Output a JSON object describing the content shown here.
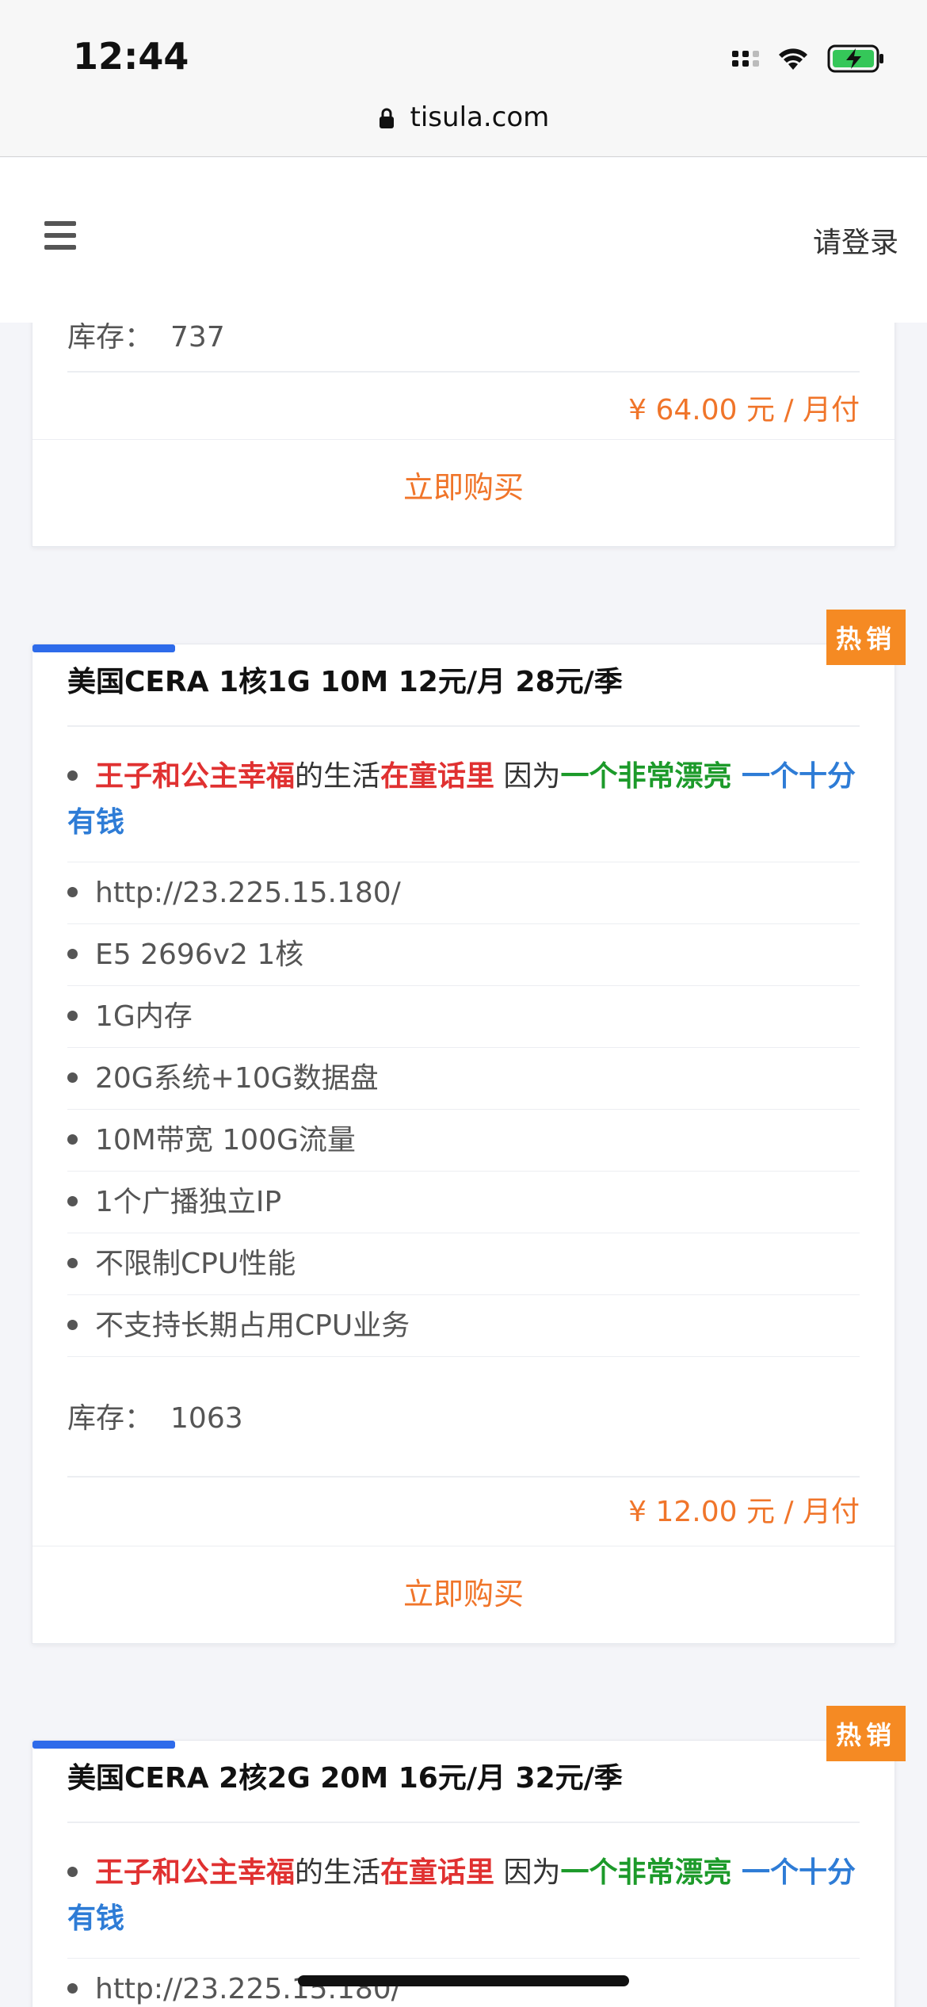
{
  "status_bar": {
    "time": "12:44",
    "url": "tisula.com",
    "icons": [
      "signal-icon",
      "wifi-icon",
      "battery-charging-icon",
      "lock-icon"
    ]
  },
  "header": {
    "menu_icon": "hamburger-menu-icon",
    "login_label": "请登录"
  },
  "colors": {
    "accent_orange": "#f0752a",
    "badge_orange": "#f58a23",
    "topline_blue": "#2e6bea",
    "text_red": "#e03131",
    "text_green": "#1c9a2a",
    "text_blue": "#2e7cd6"
  },
  "top_card": {
    "stock_label": "库存：",
    "stock_value": "737",
    "price": "¥ 64.00 元 / 月付",
    "buy_label": "立即购买"
  },
  "products": [
    {
      "badge": "热销",
      "title": "美国CERA 1核1G 10M 12元/月 28元/季",
      "desc": {
        "red1": "王子和公主幸福",
        "plain1": "的生活",
        "red2": "在童话里",
        "plain2": " 因为",
        "green": "一个非常漂亮",
        "blue": " 一个十分有钱"
      },
      "features": [
        "http://23.225.15.180/",
        "E5 2696v2 1核",
        "1G内存",
        "20G系统+10G数据盘",
        "10M带宽 100G流量",
        "1个广播独立IP",
        "不限制CPU性能",
        "不支持长期占用CPU业务"
      ],
      "stock_label": "库存：",
      "stock_value": "1063",
      "price": "¥ 12.00 元 / 月付",
      "buy_label": "立即购买"
    },
    {
      "badge": "热销",
      "title": "美国CERA 2核2G 20M 16元/月 32元/季",
      "desc": {
        "red1": "王子和公主幸福",
        "plain1": "的生活",
        "red2": "在童话里",
        "plain2": " 因为",
        "green": "一个非常漂亮",
        "blue": " 一个十分有钱"
      },
      "features": [
        "http://23.225.15.180/"
      ]
    }
  ]
}
